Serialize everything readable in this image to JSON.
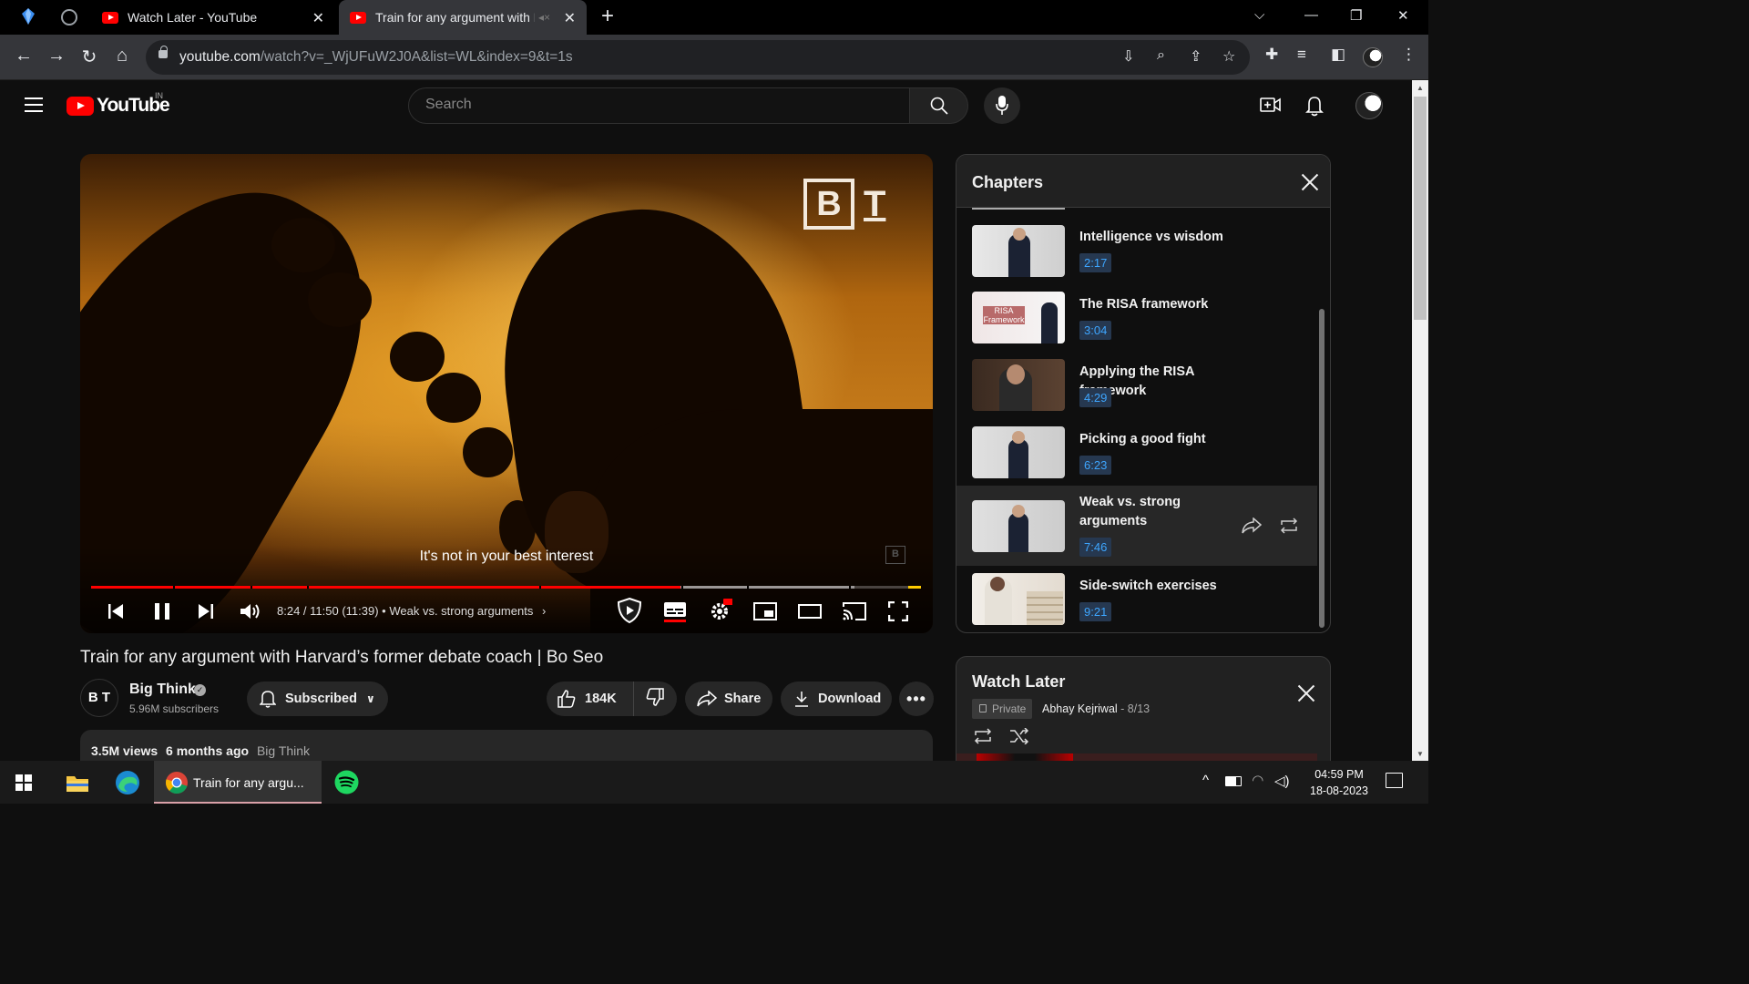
{
  "browser": {
    "tabs": [
      {
        "title": "Watch Later - YouTube",
        "active": false
      },
      {
        "title": "Train for any argument with H",
        "active": true
      }
    ],
    "url_host": "youtube.com",
    "url_path": "/watch?v=_WjUFuW2J0A&list=WL&index=9&t=1s"
  },
  "masthead": {
    "logo_text": "YouTube",
    "country": "IN",
    "search_placeholder": "Search"
  },
  "player": {
    "brand_b": "B",
    "brand_t": "T",
    "caption": "It's not in your best interest",
    "time": "8:24 / 11:50 (11:39)",
    "current_chapter": "Weak vs. strong arguments",
    "progress_played": 0.71,
    "progress_buffered": 0.92
  },
  "video": {
    "title": "Train for any argument with Harvard’s former debate coach | Bo Seo",
    "channel_initials": "B T",
    "channel_name": "Big Think",
    "subscribers": "5.96M subscribers",
    "subscribe_label": "Subscribed",
    "likes": "184K",
    "share_label": "Share",
    "download_label": "Download",
    "views": "3.5M views",
    "age": "6 months ago",
    "desc_channel": "Big Think"
  },
  "chapters": {
    "heading": "Chapters",
    "items": [
      {
        "title": "Intelligence vs wisdom",
        "time": "2:17",
        "active": false
      },
      {
        "title": "The RISA framework",
        "time": "3:04",
        "active": false
      },
      {
        "title": "Applying the RISA framework",
        "time": "4:29",
        "active": false
      },
      {
        "title": "Picking a good fight",
        "time": "6:23",
        "active": false
      },
      {
        "title": "Weak vs. strong arguments",
        "time": "7:46",
        "active": true
      },
      {
        "title": "Side-switch exercises",
        "time": "9:21",
        "active": false
      }
    ],
    "thumb_text_risa": "RISA Framework"
  },
  "watch_later": {
    "title": "Watch Later",
    "privacy": "Private",
    "owner": "Abhay Kejriwal",
    "position": "- 8/13"
  },
  "taskbar": {
    "chrome_label": "Train for any argu...",
    "time": "04:59 PM",
    "date": "18-08-2023"
  },
  "colors": {
    "accent_red": "#ff0000",
    "chapter_time_blue": "#3ea6ff",
    "page_bg": "#0f0f0f"
  }
}
